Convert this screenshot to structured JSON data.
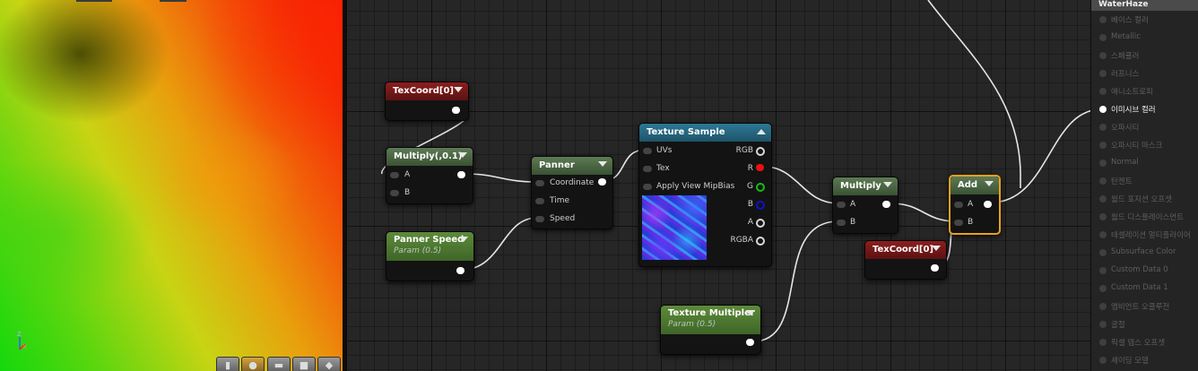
{
  "preview": {
    "axis": {
      "z": "Z",
      "x": "X"
    },
    "toolbar": [
      "cylinder",
      "sphere",
      "plane",
      "cube",
      "custom-mesh"
    ]
  },
  "nodes": {
    "texcoord_top": {
      "title": "TexCoord[0]"
    },
    "multiply_01": {
      "title": "Multiply(,0.1)",
      "inputs": [
        "A",
        "B"
      ]
    },
    "panner": {
      "title": "Panner",
      "inputs": [
        "Coordinate",
        "Time",
        "Speed"
      ]
    },
    "panner_speed": {
      "title": "Panner Speed",
      "subtitle": "Param (0.5)"
    },
    "texture_sample": {
      "title": "Texture Sample",
      "inputs": [
        "UVs",
        "Tex",
        "Apply View MipBias"
      ],
      "outputs": [
        "RGB",
        "R",
        "G",
        "B",
        "A",
        "RGBA"
      ]
    },
    "texture_multiplier": {
      "title": "Texture Multipler",
      "subtitle": "Param (0.5)"
    },
    "multiply": {
      "title": "Multiply",
      "inputs": [
        "A",
        "B"
      ]
    },
    "texcoord_bottom": {
      "title": "TexCoord[0]"
    },
    "add": {
      "title": "Add",
      "inputs": [
        "A",
        "B"
      ]
    }
  },
  "colors": {
    "pin_r": "#e81010",
    "pin_g": "#10c010",
    "pin_b": "#1010d0",
    "selection": "#e8a020"
  },
  "material_panel": {
    "title": "WaterHaze",
    "inputs": [
      {
        "label": "베이스 컬러",
        "active": false
      },
      {
        "label": "Metallic",
        "active": false
      },
      {
        "label": "스페큘러",
        "active": false
      },
      {
        "label": "러프니스",
        "active": false
      },
      {
        "label": "애니소트로피",
        "active": false
      },
      {
        "label": "이미시브 컬러",
        "active": true
      },
      {
        "label": "오파시티",
        "active": false
      },
      {
        "label": "오파시티 마스크",
        "active": false
      },
      {
        "label": "Normal",
        "active": false
      },
      {
        "label": "탄젠트",
        "active": false
      },
      {
        "label": "월드 포지션 오프셋",
        "active": false
      },
      {
        "label": "월드 디스플레이스먼트",
        "active": false
      },
      {
        "label": "테셀레이션 멀티플라이어",
        "active": false
      },
      {
        "label": "Subsurface Color",
        "active": false
      },
      {
        "label": "Custom Data 0",
        "active": false
      },
      {
        "label": "Custom Data 1",
        "active": false
      },
      {
        "label": "앰비언트 오클루전",
        "active": false
      },
      {
        "label": "굴절",
        "active": false
      },
      {
        "label": "픽셀 뎁스 오프셋",
        "active": false
      },
      {
        "label": "셰이딩 모델",
        "active": false
      }
    ]
  }
}
